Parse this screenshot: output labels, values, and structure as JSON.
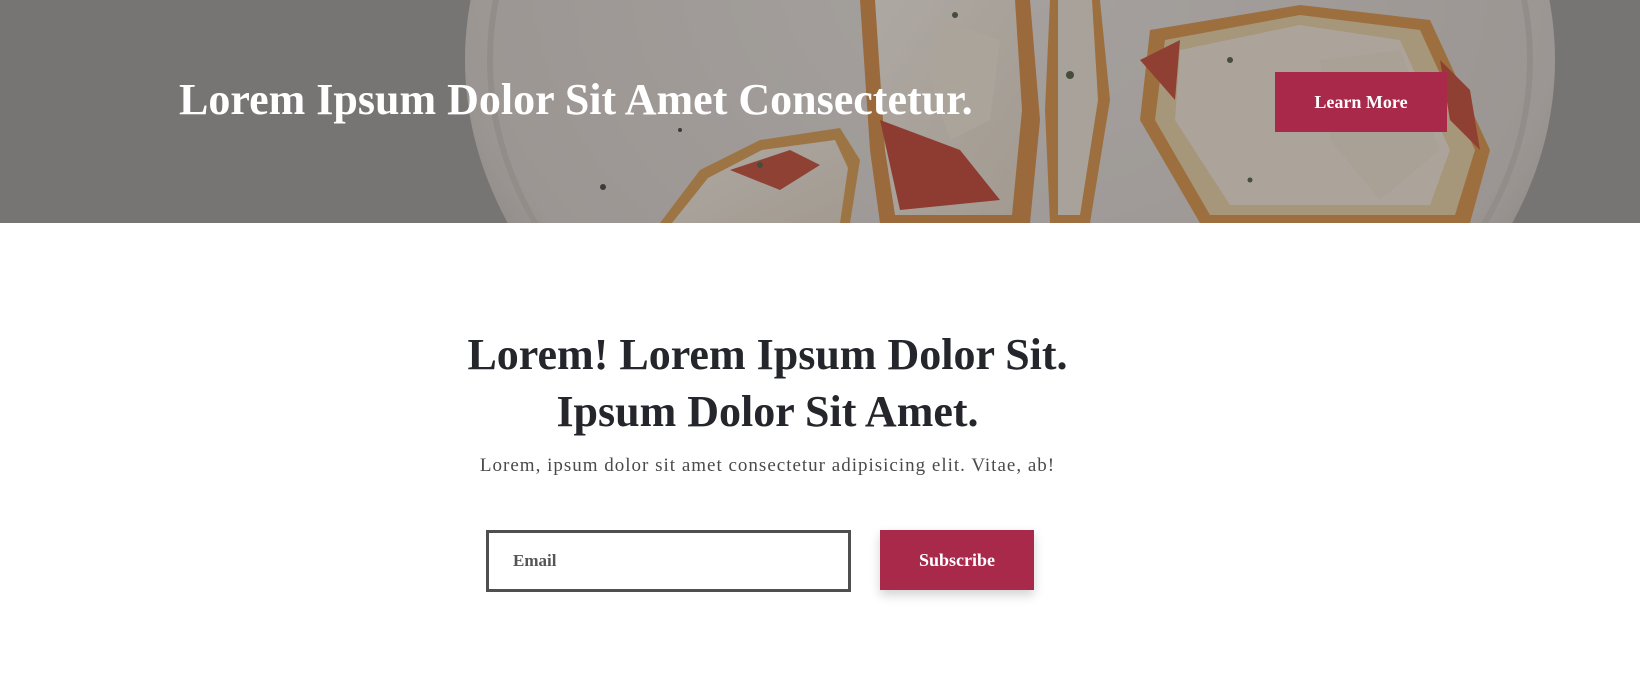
{
  "hero": {
    "title": "Lorem Ipsum Dolor Sit Amet Consectetur.",
    "button_label": "Learn More",
    "background_image": "pizza-toast-plate-photo"
  },
  "subscribe": {
    "heading_line1": "Lorem! Lorem Ipsum Dolor Sit.",
    "heading_line2": "Ipsum Dolor Sit Amet.",
    "description": "Lorem, ipsum dolor sit amet consectetur adipisicing elit. Vitae, ab!",
    "email_placeholder": "Email",
    "button_label": "Subscribe"
  },
  "colors": {
    "accent": "#a8294a",
    "heading": "#25262b",
    "body_text": "#4a4a4a",
    "hero_overlay": "#3c3a3c"
  }
}
